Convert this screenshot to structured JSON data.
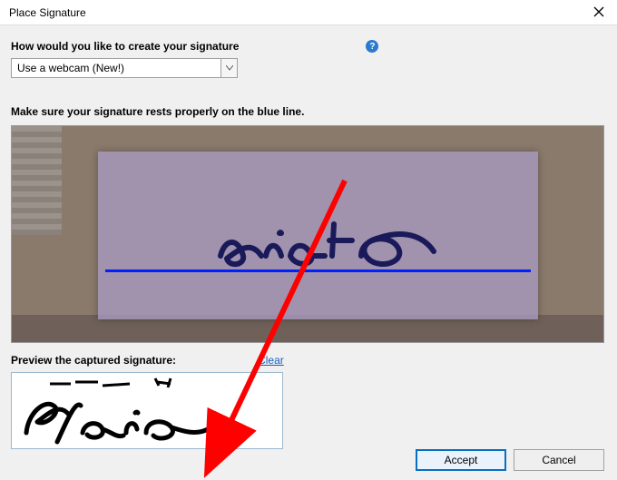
{
  "window": {
    "title": "Place Signature"
  },
  "form": {
    "question": "How would you like to create your signature",
    "selected_option": "Use a webcam (New!)",
    "instruction": "Make sure your signature rests properly on the blue line."
  },
  "preview": {
    "label": "Preview the captured signature:",
    "clear": "Clear",
    "signature_text": "Elsie"
  },
  "buttons": {
    "accept": "Accept",
    "cancel": "Cancel"
  },
  "colors": {
    "guideline": "#0020ff",
    "accept_border": "#0a6ec0"
  }
}
